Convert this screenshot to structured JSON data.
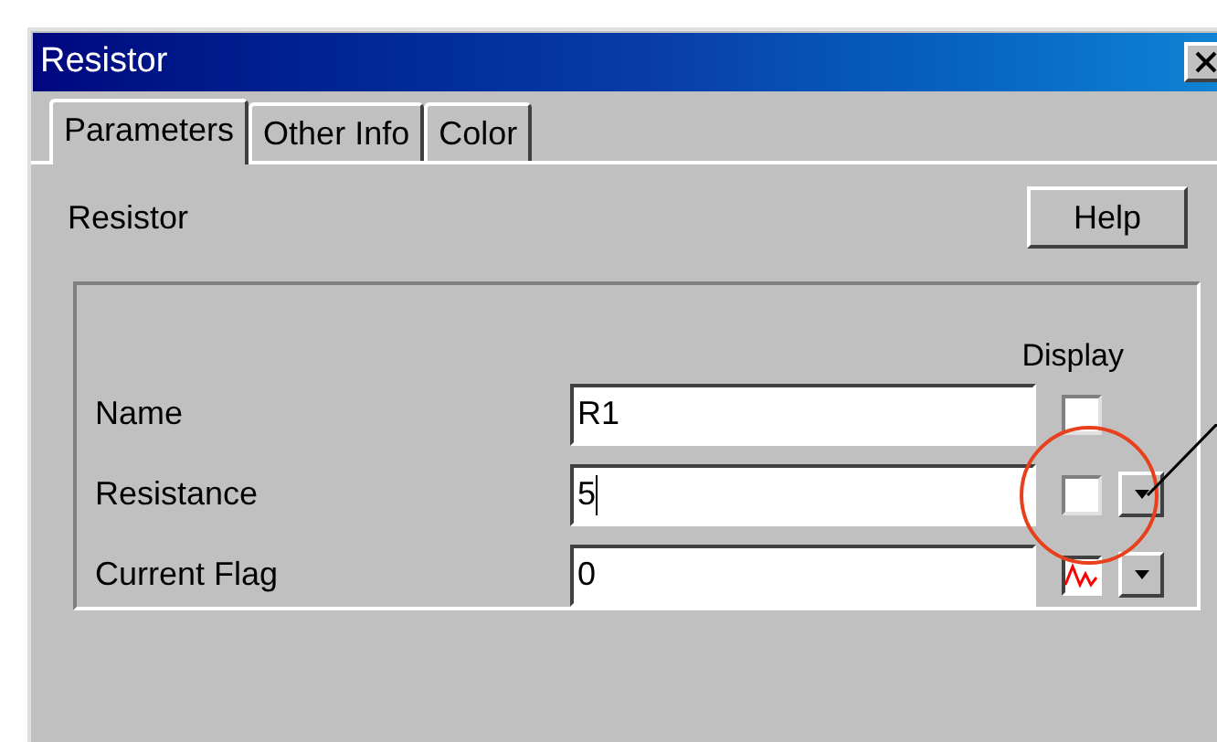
{
  "window": {
    "title": "Resistor"
  },
  "tabs": [
    {
      "label": "Parameters",
      "selected": true
    },
    {
      "label": "Other Info",
      "selected": false
    },
    {
      "label": "Color",
      "selected": false
    }
  ],
  "heading": "Resistor",
  "help_button": "Help",
  "display_header": "Display",
  "rows": [
    {
      "label": "Name",
      "value": "R1",
      "kind": "checkbox",
      "checked": false,
      "dropdown": false,
      "focused": false
    },
    {
      "label": "Resistance",
      "value": "5",
      "kind": "checkbox",
      "checked": false,
      "dropdown": true,
      "focused": true
    },
    {
      "label": "Current Flag",
      "value": "0",
      "kind": "flag-symbol",
      "dropdown": true,
      "focused": false
    }
  ]
}
